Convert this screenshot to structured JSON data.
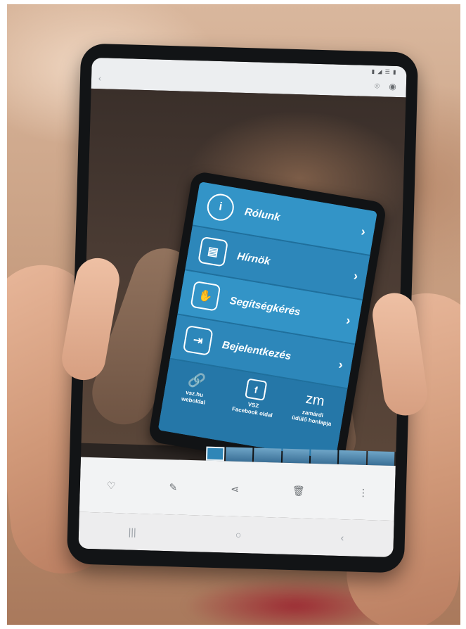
{
  "tablet": {
    "statusbar": "▮ ◢ ☰ ▮",
    "topbar": {
      "back_icon": "‹",
      "icons": [
        "⌾",
        "◉"
      ]
    }
  },
  "app": {
    "menu": [
      {
        "icon": "i",
        "label": "Rólunk",
        "chevron": "›"
      },
      {
        "icon": "▤",
        "label": "Hírnök",
        "chevron": "›"
      },
      {
        "icon": "✋",
        "label": "Segítségkérés",
        "chevron": "›"
      },
      {
        "icon": "⇥",
        "label": "Bejelentkezés",
        "chevron": "›"
      }
    ],
    "links": [
      {
        "icon": "🔗",
        "label_line1": "vsz.hu",
        "label_line2": "weboldal"
      },
      {
        "icon": "f",
        "label_line1": "VSZ",
        "label_line2": "Facebook oldal"
      },
      {
        "icon": "zm",
        "label_line1": "zamárdi",
        "label_line2": "üdülő honlapja"
      }
    ]
  },
  "gallery": {
    "check_icon": "✓",
    "actions": [
      "♡",
      "✎",
      "⋖",
      "🗑",
      "⋮"
    ],
    "nav": [
      "|||",
      "○",
      "‹"
    ]
  }
}
